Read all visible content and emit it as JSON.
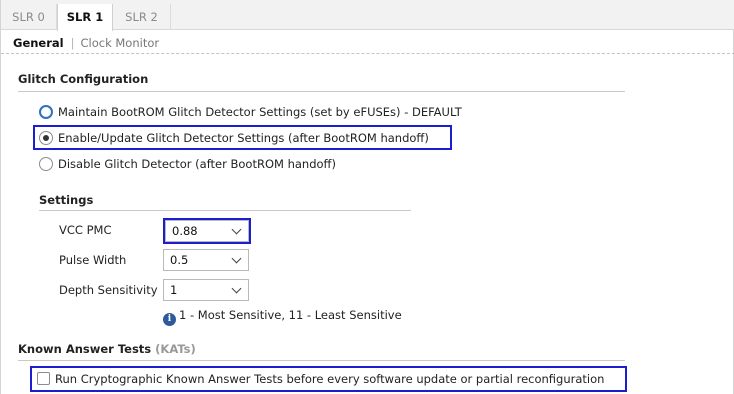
{
  "slr_tabs": [
    {
      "label": "SLR 0",
      "active": false
    },
    {
      "label": "SLR 1",
      "active": true
    },
    {
      "label": "SLR 2",
      "active": false
    }
  ],
  "sub_tabs": {
    "general": "General",
    "separator": "|",
    "clock_monitor": "Clock Monitor"
  },
  "glitch": {
    "title": "Glitch Configuration",
    "options": [
      {
        "label": "Maintain BootROM Glitch Detector Settings (set by eFUSEs) - DEFAULT",
        "selected": false
      },
      {
        "label": "Enable/Update Glitch Detector Settings (after BootROM handoff)",
        "selected": true
      },
      {
        "label": "Disable Glitch Detector (after BootROM handoff)",
        "selected": false
      }
    ]
  },
  "settings": {
    "title": "Settings",
    "vcc_pmc": {
      "label": "VCC PMC",
      "value": "0.88"
    },
    "pulse_width": {
      "label": "Pulse Width",
      "value": "0.5"
    },
    "depth_sensitivity": {
      "label": "Depth Sensitivity",
      "value": "1"
    },
    "info_icon": "info-icon",
    "info_text": "1 - Most Sensitive, 11 - Least Sensitive"
  },
  "kat": {
    "title": "Known Answer Tests",
    "title_suffix": "(KATs)",
    "checkbox_label": "Run Cryptographic Known Answer Tests before every software update or partial reconfiguration",
    "checked": false
  },
  "colors": {
    "highlight": "#1c1cd0",
    "info_icon": "#2d5a9a",
    "radio_accent": "#2f6fc4"
  }
}
